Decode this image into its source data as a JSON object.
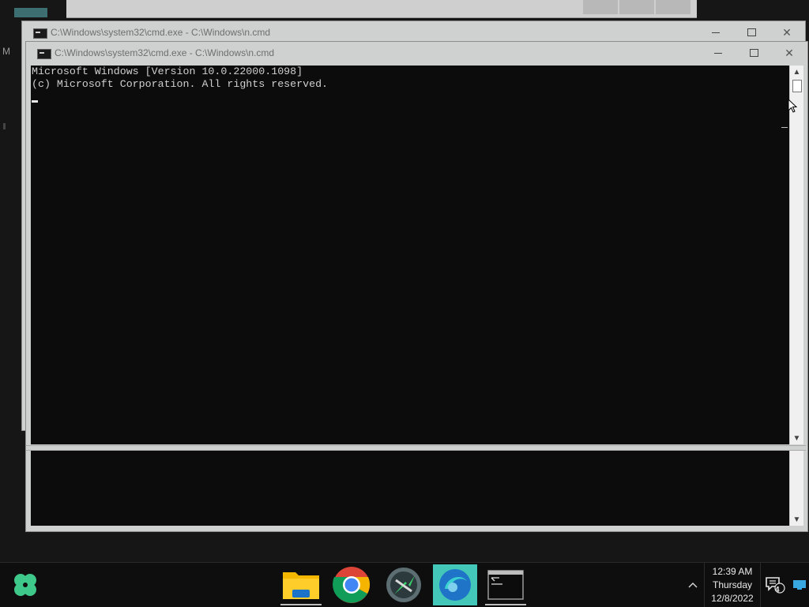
{
  "desktop": {
    "letter": "M"
  },
  "windows": {
    "back": {
      "title": "C:\\Windows\\system32\\cmd.exe - C:\\Windows\\n.cmd"
    },
    "front": {
      "title": "C:\\Windows\\system32\\cmd.exe - C:\\Windows\\n.cmd",
      "console_lines": [
        "Microsoft Windows [Version 10.0.22000.1098]",
        "(c) Microsoft Corporation. All rights reserved."
      ]
    }
  },
  "taskbar": {
    "apps": [
      "start-icon",
      "file-explorer-icon",
      "chrome-icon",
      "app-icon",
      "browser-icon",
      "cmd-icon"
    ],
    "tray": {
      "time": "12:39 AM",
      "day": "Thursday",
      "date": "12/8/2022",
      "notification_count": "4"
    }
  },
  "colors": {
    "console_bg": "#0c0c0c",
    "taskbar_bg": "#0e0e0e",
    "window_frame": "#cfd0d0"
  }
}
